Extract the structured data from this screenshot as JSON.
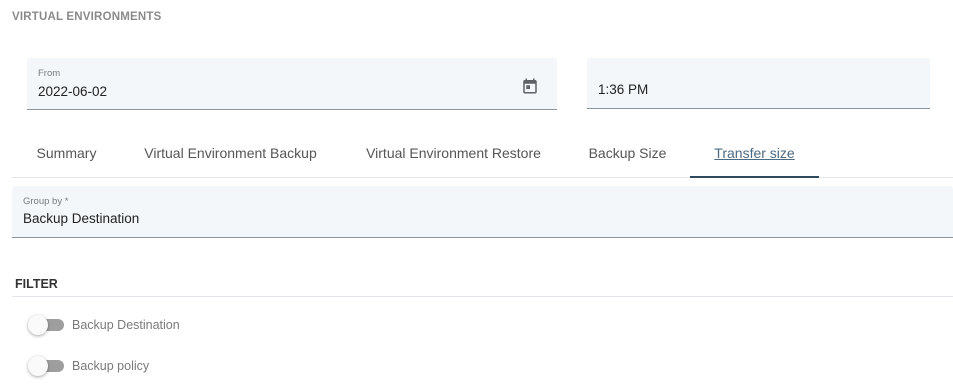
{
  "section": {
    "title": "VIRTUAL ENVIRONMENTS"
  },
  "date_filter": {
    "from_label": "From",
    "from_value": "2022-06-02",
    "time_value": "1:36 PM"
  },
  "tabs": [
    {
      "label": "Summary",
      "active": false
    },
    {
      "label": "Virtual Environment Backup",
      "active": false
    },
    {
      "label": "Virtual Environment Restore",
      "active": false
    },
    {
      "label": "Backup Size",
      "active": false
    },
    {
      "label": "Transfer size",
      "active": true
    }
  ],
  "group_by": {
    "label": "Group by *",
    "value": "Backup Destination"
  },
  "filter": {
    "title": "FILTER",
    "toggles": [
      {
        "label": "Backup Destination",
        "on": false
      },
      {
        "label": "Backup policy",
        "on": false
      }
    ]
  },
  "colors": {
    "field_bg": "#f3f7fa",
    "active_tab": "#4c6a82",
    "active_indicator": "#2f4a60",
    "toggle_track_off": "#9e9e9e"
  },
  "icons": {
    "date_picker": "calendar-icon"
  }
}
